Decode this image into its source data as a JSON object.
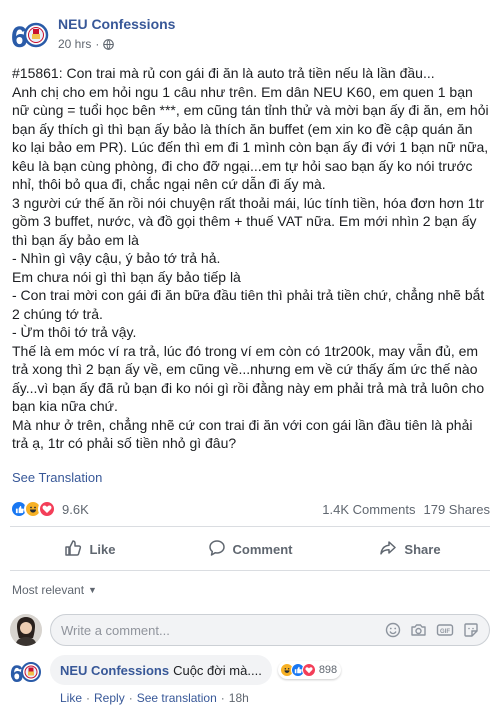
{
  "post": {
    "page_name": "NEU Confessions",
    "time": "20 hrs",
    "body": [
      "#15861: Con trai mà rủ con gái đi ăn là auto trả tiền nếu là lần đầu...",
      "Anh chị cho em hỏi ngu 1 câu như trên. Em dân NEU K60, em quen 1 bạn nữ cùng = tuổi học bên ***, em cũng tán tỉnh thử và mời bạn ấy đi ăn, em hỏi bạn ấy thích gì thì bạn ấy bảo là thích ăn buffet (em xin ko đề cập quán ăn ko lại bảo em PR). Lúc đến thì em đi 1 mình còn bạn ấy đi với 1 bạn nữ nữa, kêu là bạn cùng phòng, đi cho đỡ ngại...em tự hỏi sao bạn ấy ko nói trước nhỉ, thôi bỏ qua đi, chắc ngại nên cứ dẫn đi ấy mà.",
      "3 người cứ thế ăn rồi nói chuyện rất thoải mái, lúc tính tiền, hóa đơn hơn 1tr gồm 3 buffet, nước, và đồ gọi thêm + thuế VAT nữa. Em mới nhìn 2 bạn ấy thì bạn ấy bảo em là",
      "- Nhìn gì vậy cậu, ý bảo tớ trả hả.",
      "Em chưa nói gì thì bạn ấy bảo tiếp là",
      "- Con trai mời con gái đi ăn bữa đầu tiên thì phải trả tiền chứ, chẳng nhẽ bắt 2 chúng tớ trả.",
      "- Ừm thôi tớ trả vậy.",
      "Thế là em móc ví ra trả, lúc đó trong ví em còn có 1tr200k, may vẫn đủ, em trả xong thì 2 bạn ấy về, em cũng về...nhưng em về cứ thấy ấm ức thế nào ấy...vì bạn ấy đã rủ bạn đi ko nói gì rồi đằng này em phải trả mà trả luôn cho bạn kia nữa chứ.",
      "Mà như ở trên, chẳng nhẽ cứ con trai đi ăn với con gái lần đầu tiên là phải trả ạ, 1tr có phải số tiền nhỏ gì đâu?"
    ],
    "see_translation": "See Translation",
    "reaction_count": "9.6K",
    "comments_count": "1.4K Comments",
    "shares_count": "179 Shares"
  },
  "actions": {
    "like": "Like",
    "comment": "Comment",
    "share": "Share"
  },
  "comments_section": {
    "sort_label": "Most relevant",
    "placeholder": "Write a comment..."
  },
  "top_comment": {
    "author": "NEU Confessions",
    "text": "Cuộc đời mà....",
    "reaction_count": "898",
    "like": "Like",
    "reply": "Reply",
    "see_translation": "See translation",
    "time": "18h"
  },
  "colors": {
    "link_blue": "#385898",
    "like_blue": "#1877f2",
    "love_red": "#f33e58",
    "haha_yellow": "#f7b125"
  },
  "icons": [
    "page-logo",
    "globe-icon",
    "like-reaction-icon",
    "haha-reaction-icon",
    "love-reaction-icon",
    "thumbs-up-icon",
    "comment-icon",
    "share-icon",
    "smiley-icon",
    "camera-icon",
    "gif-icon",
    "sticker-icon"
  ]
}
